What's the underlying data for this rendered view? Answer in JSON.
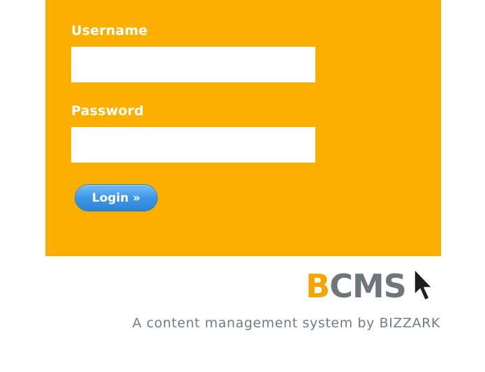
{
  "login_form": {
    "username_label": "Username",
    "username_value": "",
    "password_label": "Password",
    "password_value": "",
    "login_button_label": "Login »"
  },
  "branding": {
    "logo_initial": "B",
    "logo_rest": "CMS",
    "tagline": "A content management system by BIZZARK"
  },
  "colors": {
    "panel_background": "#fbb000",
    "button_blue": "#3e97e6",
    "logo_orange": "#f5a500",
    "logo_gray": "#6e757b",
    "tagline_gray": "#737b83"
  },
  "icons": {
    "cursor": "arrow-cursor-icon"
  }
}
